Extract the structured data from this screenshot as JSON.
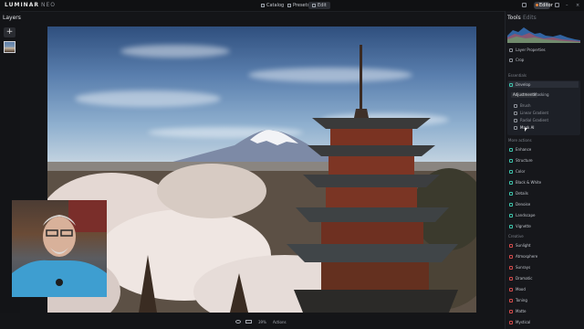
{
  "app": {
    "brand": "LUMINAR",
    "brand_suffix": "NEO"
  },
  "topnav": {
    "catalog_label": "Catalog",
    "presets_label": "Presets",
    "edit_label": "Edit",
    "right_pill_label": "Editor"
  },
  "layers": {
    "title": "Layers",
    "add_symbol": "+"
  },
  "tools_panel": {
    "tools_tab": "Tools",
    "edits_tab": "Edits",
    "layer_properties": "Layer Properties",
    "crop": "Crop",
    "essentials_section": "Essentials",
    "develop": "Develop",
    "develop_tabs": [
      "Adjustments",
      "Masking"
    ],
    "mask_items": [
      "Brush",
      "Linear Gradient",
      "Radial Gradient",
      "Mask AI"
    ],
    "more_section": "More actions",
    "essentials_tools": [
      "Enhance",
      "Structure",
      "Color",
      "Black & White",
      "Details",
      "Denoise",
      "Landscape",
      "Vignette"
    ],
    "creative_section": "Creative",
    "creative_tools": [
      "Sunlight",
      "Atmosphere",
      "Sunrays",
      "Dramatic",
      "Mood",
      "Toning",
      "Matte",
      "Mystical"
    ]
  },
  "bottombar": {
    "zoom": "39%",
    "actions": "Actions"
  },
  "colors": {
    "accent_orange": "#e8843a",
    "panel_bg": "#16171b",
    "highlight_row": "#2a2e37"
  },
  "icons": [
    "plus-icon",
    "eye-icon",
    "compare-icon",
    "gear-icon",
    "histogram-icon"
  ]
}
